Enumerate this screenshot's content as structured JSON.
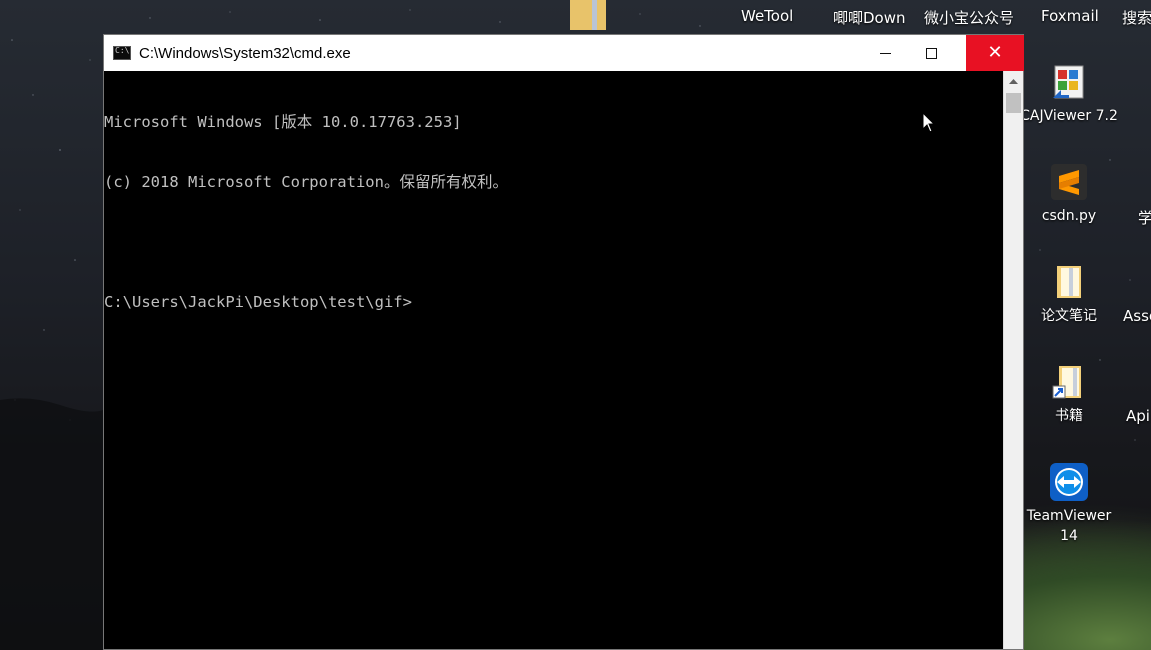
{
  "desktop": {
    "top_labels": [
      "WeTool",
      "唧唧Down",
      "微小宝公众号",
      "Foxmail",
      "搜索"
    ],
    "icons": [
      {
        "label": "CAJViewer 7.2",
        "icon": "cajviewer-icon"
      },
      {
        "label": "csdn.py",
        "icon": "sublime-text-icon"
      },
      {
        "label": "论文笔记",
        "icon": "folder-icon"
      },
      {
        "label": "书籍",
        "icon": "folder-shortcut-icon"
      },
      {
        "label": "TeamViewer 14",
        "icon": "teamviewer-icon"
      }
    ],
    "right_edge_labels": [
      "学",
      "Asse",
      "Api"
    ]
  },
  "window": {
    "title": "C:\\Windows\\System32\\cmd.exe",
    "controls": {
      "minimize": "minimize",
      "maximize": "maximize",
      "close": "✕"
    },
    "console_lines": [
      "Microsoft Windows [版本 10.0.17763.253]",
      "(c) 2018 Microsoft Corporation。保留所有权利。",
      "",
      "C:\\Users\\JackPi\\Desktop\\test\\gif>"
    ]
  },
  "colors": {
    "console_bg": "#000000",
    "console_fg": "#c0c0c0",
    "close_button": "#e81123"
  }
}
